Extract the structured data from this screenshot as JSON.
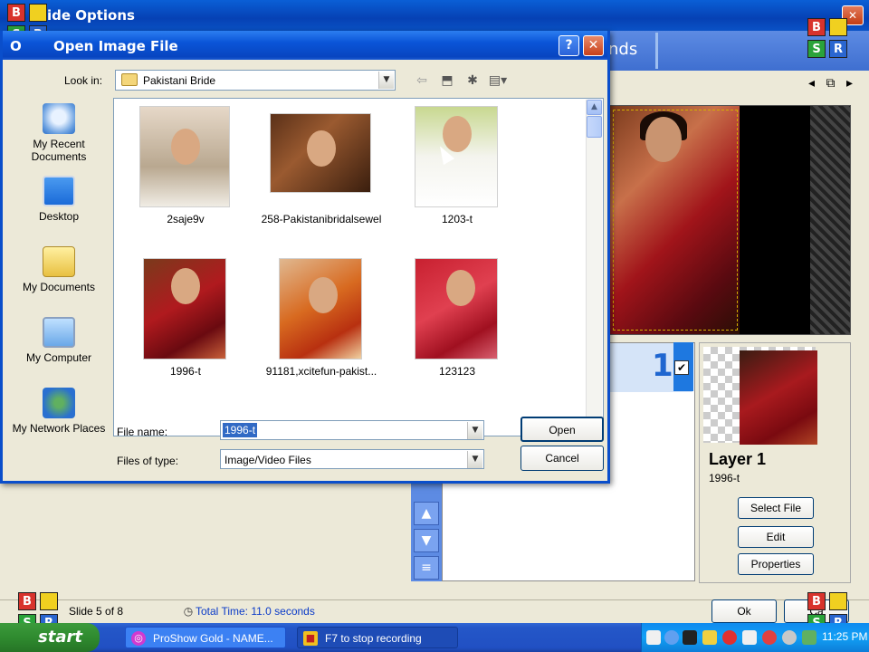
{
  "background_window": {
    "title": "Slide Options",
    "tab_label": "nds",
    "preview_nav": "◂ ⧉ ▸",
    "layer_number": "1",
    "layer_checked": "✔",
    "layer_name": "Layer 1",
    "layer_file": "1996-t",
    "buttons": {
      "select_file": "Select File",
      "edit": "Edit",
      "properties": "Properties",
      "ok": "Ok",
      "cancel": "Ca"
    },
    "status": {
      "slide": "Slide 5 of 8",
      "total_time": "Total Time: 11.0 seconds"
    },
    "side_buttons": [
      "▲",
      "▼",
      "≡"
    ]
  },
  "logo": {
    "b": "B",
    "s": "S",
    "r": "R",
    "y": ""
  },
  "dialog": {
    "title": "Open Image File",
    "title_prefix": "O",
    "help": "?",
    "close": "✕",
    "look_in_label": "Look in:",
    "look_in_value": "Pakistani Bride",
    "toolbar_icons": [
      "back-icon",
      "up-folder-icon",
      "new-folder-icon",
      "views-icon"
    ],
    "places": [
      {
        "label": "My Recent Documents",
        "icon": "recent-documents-icon"
      },
      {
        "label": "Desktop",
        "icon": "desktop-icon"
      },
      {
        "label": "My Documents",
        "icon": "my-documents-icon"
      },
      {
        "label": "My Computer",
        "icon": "my-computer-icon"
      },
      {
        "label": "My Network Places",
        "icon": "network-places-icon"
      }
    ],
    "files": [
      {
        "name": "2saje9v"
      },
      {
        "name": "258-Pakistanibridalsewel"
      },
      {
        "name": "1203-t"
      },
      {
        "name": "1996-t"
      },
      {
        "name": "91181,xcitefun-pakist..."
      },
      {
        "name": "123123"
      }
    ],
    "file_name_label": "File name:",
    "file_name_value": "1996-t",
    "file_type_label": "Files of type:",
    "file_type_value": "Image/Video Files",
    "open_label": "Open",
    "cancel_label": "Cancel"
  },
  "taskbar": {
    "start": "start",
    "tasks": [
      "ProShow Gold - NAME...",
      "F7 to stop recording"
    ],
    "time": "11:25 PM"
  },
  "colors": {
    "xp_blue": "#0a55d8",
    "selection": "#316ac5",
    "start_green": "#2f8b2f"
  }
}
